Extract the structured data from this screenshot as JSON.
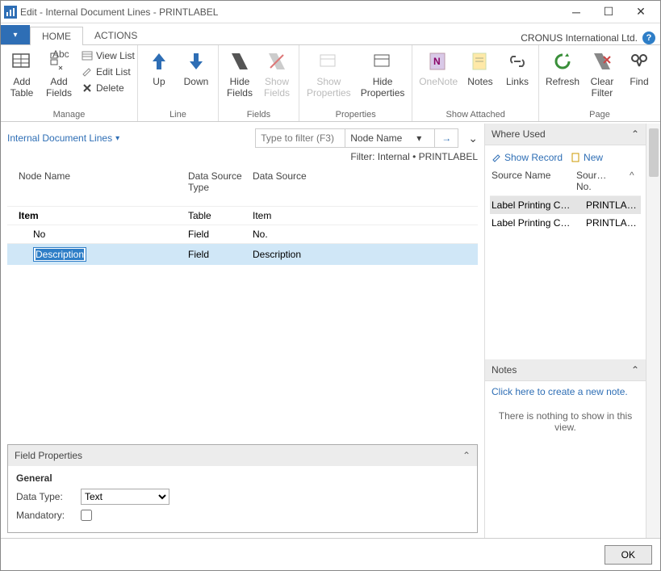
{
  "window": {
    "title": "Edit - Internal Document Lines - PRINTLABEL"
  },
  "company": "CRONUS International Ltd.",
  "tabs": {
    "home": "HOME",
    "actions": "ACTIONS"
  },
  "ribbon": {
    "manage": {
      "label": "Manage",
      "add_table": "Add\nTable",
      "add_fields": "Add\nFields",
      "view_list": "View List",
      "edit_list": "Edit List",
      "delete": "Delete"
    },
    "line": {
      "label": "Line",
      "up": "Up",
      "down": "Down"
    },
    "fields": {
      "label": "Fields",
      "hide": "Hide\nFields",
      "show": "Show\nFields"
    },
    "properties": {
      "label": "Properties",
      "show": "Show\nProperties",
      "hide": "Hide\nProperties"
    },
    "show_attached": {
      "label": "Show Attached",
      "onenote": "OneNote",
      "notes": "Notes",
      "links": "Links"
    },
    "page": {
      "label": "Page",
      "refresh": "Refresh",
      "clear_filter": "Clear\nFilter",
      "find": "Find"
    }
  },
  "page_title": "Internal Document Lines",
  "filter": {
    "placeholder": "Type to filter (F3)",
    "field": "Node Name",
    "text": "Filter: Internal • PRINTLABEL"
  },
  "grid": {
    "headers": {
      "node_name": "Node Name",
      "dstype": "Data Source\nType",
      "ds": "Data Source"
    },
    "rows": [
      {
        "name": "Item",
        "dstype": "Table",
        "ds": "Item",
        "indent": 0,
        "bold": true,
        "selected": false,
        "editing": false
      },
      {
        "name": "No",
        "dstype": "Field",
        "ds": "No.",
        "indent": 1,
        "bold": false,
        "selected": false,
        "editing": false
      },
      {
        "name": "Description",
        "dstype": "Field",
        "ds": "Description",
        "indent": 1,
        "bold": false,
        "selected": true,
        "editing": true
      }
    ]
  },
  "field_properties": {
    "title": "Field Properties",
    "general": "General",
    "data_type_label": "Data Type:",
    "data_type_value": "Text",
    "mandatory_label": "Mandatory:",
    "mandatory_value": false
  },
  "where_used": {
    "title": "Where Used",
    "show_record": "Show Record",
    "new": "New",
    "headers": {
      "source_name": "Source Name",
      "source_no": "Sour…\nNo."
    },
    "rows": [
      {
        "name": "Label Printing C…",
        "no": "PRINTLAB…",
        "selected": true
      },
      {
        "name": "Label Printing C…",
        "no": "PRINTLAB…",
        "selected": false
      }
    ]
  },
  "notes": {
    "title": "Notes",
    "create_link": "Click here to create a new note.",
    "empty": "There is nothing to show in this view."
  },
  "footer": {
    "ok": "OK"
  }
}
